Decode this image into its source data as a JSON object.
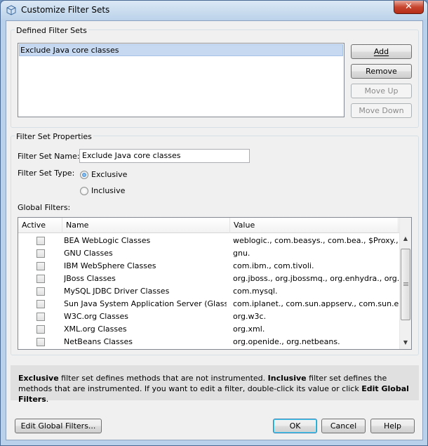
{
  "window": {
    "title": "Customize Filter Sets",
    "close_label": "✕"
  },
  "defined": {
    "group_label": "Defined Filter Sets",
    "items": [
      "Exclude Java core classes"
    ],
    "buttons": {
      "add": "Add",
      "remove": "Remove",
      "move_up": "Move Up",
      "move_down": "Move Down"
    }
  },
  "properties": {
    "group_label": "Filter Set Properties",
    "name_label": "Filter Set Name:",
    "name_value": "Exclude Java core classes",
    "type_label": "Filter Set Type:",
    "type_options": [
      "Exclusive",
      "Inclusive"
    ],
    "type_selected": "Exclusive",
    "global_label": "Global Filters:"
  },
  "table": {
    "columns": [
      "Active",
      "Name",
      "Value"
    ],
    "rows": [
      {
        "active": false,
        "name": "BEA WebLogic Classes",
        "value": "weblogic., com.beasys., com.bea., $Proxy., ..."
      },
      {
        "active": false,
        "name": "GNU Classes",
        "value": "gnu."
      },
      {
        "active": false,
        "name": "IBM WebSphere Classes",
        "value": "com.ibm., com.tivoli."
      },
      {
        "active": false,
        "name": "JBoss Classes",
        "value": "org.jboss., org.jbossmq., org.enhydra., org...."
      },
      {
        "active": false,
        "name": "MySQL JDBC Driver Classes",
        "value": "com.mysql."
      },
      {
        "active": false,
        "name": "Sun Java System Application Server (GlassFis...",
        "value": "com.iplanet., com.sun.appserv., com.sun.ent..."
      },
      {
        "active": false,
        "name": "W3C.org Classes",
        "value": "org.w3c."
      },
      {
        "active": false,
        "name": "XML.org Classes",
        "value": "org.xml."
      },
      {
        "active": false,
        "name": "NetBeans Classes",
        "value": "org.openide., org.netbeans."
      }
    ]
  },
  "info": {
    "b1": "Exclusive",
    "t1": " filter set defines methods that are not instrumented. ",
    "b2": "Inclusive",
    "t2": " filter set defines the methods that are instrumented. If you want to edit a filter, double-click its value or click ",
    "b3": "Edit Global Filters",
    "t3": "."
  },
  "footer": {
    "edit_global": "Edit Global Filters...",
    "ok": "OK",
    "cancel": "Cancel",
    "help": "Help"
  }
}
